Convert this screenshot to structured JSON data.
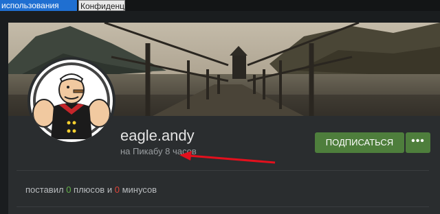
{
  "browser": {
    "tab_usage": "использования",
    "tab_privacy": "Конфиденц"
  },
  "profile": {
    "username": "eagle.andy",
    "member_since": "на Пикабу 8 часов",
    "subscribe_label": "ПОДПИСАТЬСЯ",
    "more_label": "•••",
    "stats": {
      "prefix": "поставил",
      "pluses": "0",
      "middle": "плюсов и",
      "minuses": "0",
      "suffix": "минусов"
    }
  },
  "colors": {
    "accent_green": "#4e7e3c",
    "plus_green": "#64b24a",
    "minus_red": "#e0453a",
    "arrow_red": "#e3101d"
  }
}
